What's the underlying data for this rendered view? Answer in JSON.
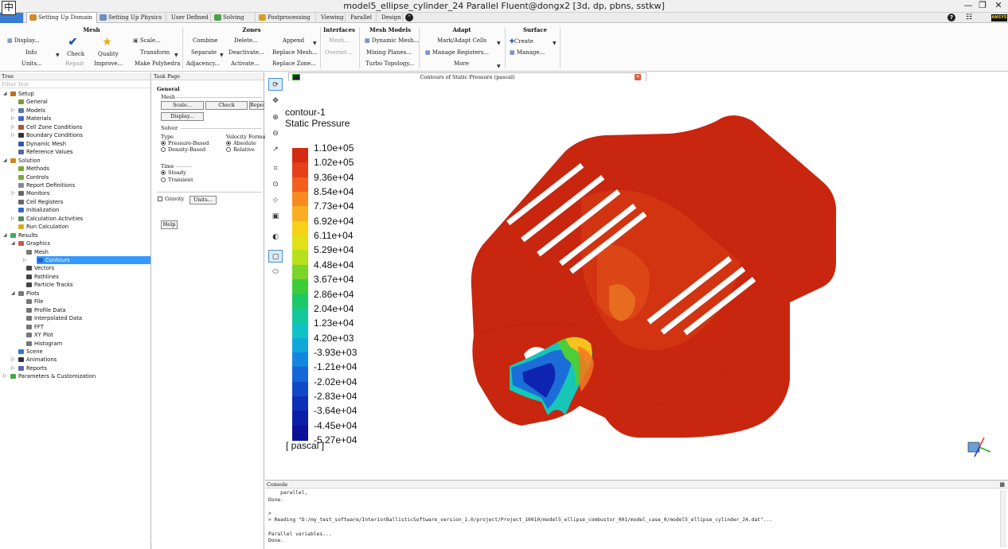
{
  "window": {
    "app_icon_glyph": "中",
    "title": "model5_ellipse_cylinder_24 Parallel Fluent@dongx2  [3d, dp, pbns, sstkw]"
  },
  "ribbon_tabs": [
    {
      "label": "",
      "kind": "file"
    },
    {
      "label": "Setting Up Domain",
      "active": true
    },
    {
      "label": "Setting Up Physics"
    },
    {
      "label": "User Defined"
    },
    {
      "label": "Solving"
    },
    {
      "label": "Postprocessing"
    },
    {
      "label": "Viewing"
    },
    {
      "label": "Parallel"
    },
    {
      "label": "Design"
    }
  ],
  "ribbon": {
    "mesh": {
      "title": "Mesh",
      "display": "Display...",
      "info": "Info",
      "units": "Units...",
      "check": "Check",
      "repair": "Repair",
      "quality": "Quality",
      "improve": "Improve...",
      "scale": "Scale...",
      "transform": "Transform",
      "make_polyhedra": "Make Polyhedra"
    },
    "zones": {
      "title": "Zones",
      "combine": "Combine",
      "separate": "Separate",
      "adjacency": "Adjacency...",
      "delete": "Delete...",
      "deactivate": "Deactivate...",
      "activate": "Activate...",
      "append": "Append",
      "replace_mesh": "Replace Mesh...",
      "replace_zone": "Replace Zone..."
    },
    "interfaces": {
      "title": "Interfaces",
      "mesh": "Mesh...",
      "overset": "Overset..."
    },
    "mesh_models": {
      "title": "Mesh Models",
      "dynamic_mesh": "Dynamic Mesh...",
      "mixing_planes": "Mixing Planes...",
      "turbo_topology": "Turbo Topology..."
    },
    "adapt": {
      "title": "Adapt",
      "mark_adapt": "Mark/Adapt Cells",
      "manage_registers": "Manage Registers...",
      "more": "More"
    },
    "surface": {
      "title": "Surface",
      "create": "Create",
      "manage": "Manage..."
    }
  },
  "tree": {
    "header": "Tree",
    "filter_placeholder": "Filter Text",
    "items": [
      {
        "label": "Setup",
        "level": 0,
        "expand": "open",
        "icon": "setup-icon",
        "color": "#c07020"
      },
      {
        "label": "General",
        "level": 1,
        "icon": "general-icon",
        "color": "#7a9a3a"
      },
      {
        "label": "Models",
        "level": 1,
        "expand": "closed",
        "icon": "models-icon",
        "color": "#5577aa"
      },
      {
        "label": "Materials",
        "level": 1,
        "expand": "closed",
        "icon": "materials-icon",
        "color": "#4466cc"
      },
      {
        "label": "Cell Zone Conditions",
        "level": 1,
        "expand": "closed",
        "icon": "cell-zone-icon",
        "color": "#aa5533"
      },
      {
        "label": "Boundary Conditions",
        "level": 1,
        "expand": "closed",
        "icon": "boundary-icon",
        "color": "#333333"
      },
      {
        "label": "Dynamic Mesh",
        "level": 1,
        "icon": "dynamic-mesh-icon",
        "color": "#3355aa"
      },
      {
        "label": "Reference Values",
        "level": 1,
        "icon": "reference-icon",
        "color": "#5566aa"
      },
      {
        "label": "Solution",
        "level": 0,
        "expand": "open",
        "icon": "solution-icon",
        "color": "#cc8822"
      },
      {
        "label": "Methods",
        "level": 1,
        "icon": "methods-icon",
        "color": "#77aa33"
      },
      {
        "label": "Controls",
        "level": 1,
        "icon": "controls-icon",
        "color": "#77aa33"
      },
      {
        "label": "Report Definitions",
        "level": 1,
        "icon": "report-def-icon",
        "color": "#888888"
      },
      {
        "label": "Monitors",
        "level": 1,
        "expand": "closed",
        "icon": "monitors-icon",
        "color": "#666666"
      },
      {
        "label": "Cell Registers",
        "level": 1,
        "icon": "cell-registers-icon",
        "color": "#666666"
      },
      {
        "label": "Initialization",
        "level": 1,
        "icon": "initialization-icon",
        "color": "#3366cc"
      },
      {
        "label": "Calculation Activities",
        "level": 1,
        "expand": "closed",
        "icon": "calc-activities-icon",
        "color": "#558855"
      },
      {
        "label": "Run Calculation",
        "level": 1,
        "icon": "run-calculation-icon",
        "color": "#ddaa22"
      },
      {
        "label": "Results",
        "level": 0,
        "expand": "open",
        "icon": "results-icon",
        "color": "#44aa66"
      },
      {
        "label": "Graphics",
        "level": 1,
        "expand": "open",
        "icon": "graphics-icon",
        "color": "#cc5544"
      },
      {
        "label": "Mesh",
        "level": 2,
        "icon": "mesh-icon",
        "color": "#777777"
      },
      {
        "label": "Contours",
        "level": 2,
        "expand": "closed",
        "icon": "contours-icon",
        "color": "#2266cc",
        "selected": true
      },
      {
        "label": "Vectors",
        "level": 2,
        "icon": "vectors-icon",
        "color": "#444444"
      },
      {
        "label": "Pathlines",
        "level": 2,
        "icon": "pathlines-icon",
        "color": "#444444"
      },
      {
        "label": "Particle Tracks",
        "level": 2,
        "icon": "particle-tracks-icon",
        "color": "#444444"
      },
      {
        "label": "Plots",
        "level": 1,
        "expand": "open",
        "icon": "plots-icon",
        "color": "#777777"
      },
      {
        "label": "File",
        "level": 2,
        "icon": "file-plot-icon",
        "color": "#777777"
      },
      {
        "label": "Profile Data",
        "level": 2,
        "icon": "profile-data-icon",
        "color": "#777777"
      },
      {
        "label": "Interpolated Data",
        "level": 2,
        "icon": "interpolated-data-icon",
        "color": "#777777"
      },
      {
        "label": "FFT",
        "level": 2,
        "icon": "fft-icon",
        "color": "#777777"
      },
      {
        "label": "XY Plot",
        "level": 2,
        "icon": "xy-plot-icon",
        "color": "#777777"
      },
      {
        "label": "Histogram",
        "level": 2,
        "icon": "histogram-icon",
        "color": "#777777"
      },
      {
        "label": "Scene",
        "level": 1,
        "icon": "scene-icon",
        "color": "#3377cc"
      },
      {
        "label": "Animations",
        "level": 1,
        "expand": "closed",
        "icon": "animations-icon",
        "color": "#333333"
      },
      {
        "label": "Reports",
        "level": 1,
        "expand": "closed",
        "icon": "reports-icon",
        "color": "#5566aa"
      },
      {
        "label": "Parameters & Customization",
        "level": 0,
        "expand": "closed",
        "icon": "parameters-icon",
        "color": "#44aa44"
      }
    ]
  },
  "task_page": {
    "header": "Task Page",
    "section": "General",
    "mesh_label": "Mesh",
    "scale_btn": "Scale...",
    "check_btn": "Check",
    "report_btn": "Repor",
    "display_btn": "Display...",
    "solver_label": "Solver",
    "type_label": "Type",
    "type_options": [
      "Pressure-Based",
      "Density-Based"
    ],
    "type_selected": 0,
    "velocity_label": "Velocity Formu",
    "velocity_options": [
      "Absolute",
      "Relative"
    ],
    "velocity_selected": 0,
    "time_label": "Time",
    "time_options": [
      "Steady",
      "Transient"
    ],
    "time_selected": 0,
    "gravity_label": "Gravity",
    "gravity_checked": false,
    "units_btn": "Units...",
    "help_btn": "Help"
  },
  "graphics": {
    "tab_title": "Contours of Static Pressure (pascal)",
    "contour_name": "contour-1",
    "quantity": "Static Pressure",
    "unit": "[ pascal ]",
    "colorbar_labels": [
      "1.10e+05",
      "1.02e+05",
      "9.36e+04",
      "8.54e+04",
      "7.73e+04",
      "6.92e+04",
      "6.11e+04",
      "5.29e+04",
      "4.48e+04",
      "3.67e+04",
      "2.86e+04",
      "2.04e+04",
      "1.23e+04",
      "4.20e+03",
      "-3.93e+03",
      "-1.21e+04",
      "-2.02e+04",
      "-2.83e+04",
      "-3.64e+04",
      "-4.45e+04",
      "-5.27e+04"
    ],
    "colorbar_colors": [
      "#d42a12",
      "#e6401a",
      "#f0601c",
      "#f78a20",
      "#fbae21",
      "#f8d01a",
      "#e2e018",
      "#b6e01c",
      "#7ad42a",
      "#3ccc38",
      "#1cc86a",
      "#14c89c",
      "#10c2c6",
      "#0fa8da",
      "#1486e0",
      "#1566d8",
      "#1248c8",
      "#0e30b8",
      "#0a1ea8",
      "#0a1098"
    ],
    "toolbar": [
      "rotate-icon",
      "pan-icon",
      "zoom-in-icon",
      "zoom-out-icon",
      "probe-icon",
      "zoom-box-icon",
      "zoom-fit-icon",
      "axes-icon",
      "snapshot-icon",
      "colormap-icon",
      "view-icon",
      "ortho-icon"
    ]
  },
  "console": {
    "header": "Console",
    "lines": [
      "    parallel,",
      "Done.",
      "",
      ">",
      "> Reading \"D:/my_test_software/InteriorBallisticSoftware_version_1.0/project/Project_10010/model5_ellipse_combustor_001/model_case_0/model5_ellipse_cylinder_24.dat\"...",
      "",
      "Parallel variables...",
      "Done."
    ]
  }
}
